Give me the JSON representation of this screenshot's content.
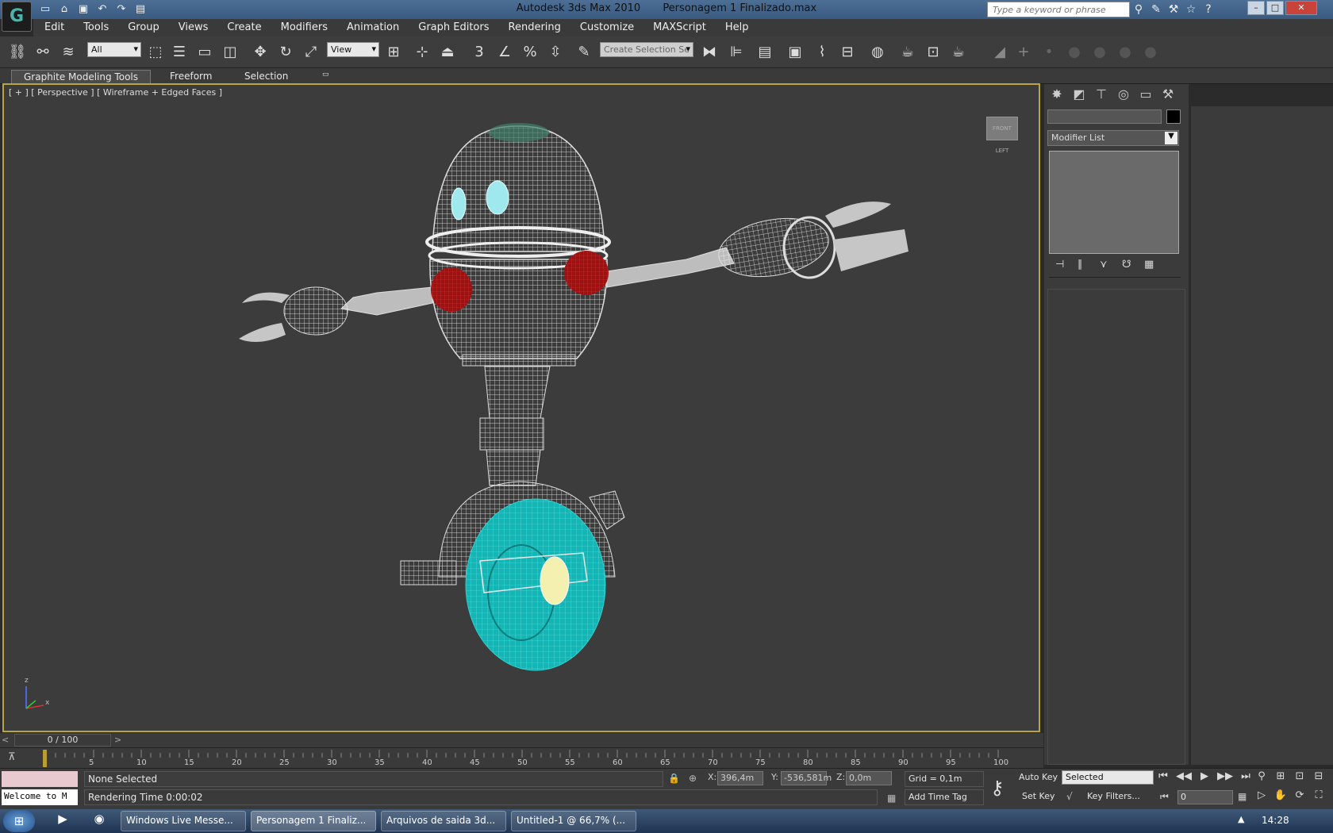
{
  "window": {
    "app_title": "Autodesk 3ds Max  2010",
    "file_title": "Personagem 1 Finalizado.max",
    "search_placeholder": "Type a keyword or phrase"
  },
  "menu": [
    "Edit",
    "Tools",
    "Group",
    "Views",
    "Create",
    "Modifiers",
    "Animation",
    "Graph Editors",
    "Rendering",
    "Customize",
    "MAXScript",
    "Help"
  ],
  "toolbar": {
    "filter_value": "All",
    "refcoord_value": "View",
    "selection_set_placeholder": "Create Selection Se",
    "snap_label": "3"
  },
  "ribbon": {
    "tabs": [
      "Graphite Modeling Tools",
      "Freeform",
      "Selection"
    ]
  },
  "viewport": {
    "label": "[ + ] [ Perspective ] [ Wireframe + Edged Faces ]",
    "viewcube_text": "FRONT  LEFT",
    "axis_z": "z",
    "axis_x": "x"
  },
  "command_panel": {
    "modifier_list": "Modifier List"
  },
  "timeslider": {
    "frame_text": "0 / 100",
    "ticks": [
      "5",
      "10",
      "15",
      "20",
      "25",
      "30",
      "35",
      "40",
      "45",
      "50",
      "55",
      "60",
      "65",
      "70",
      "75",
      "80",
      "85",
      "90",
      "95",
      "100"
    ]
  },
  "status": {
    "maxscript_text": "Welcome to M",
    "selection": "None Selected",
    "prompt": "Rendering Time  0:00:02",
    "x_label": "X:",
    "x_value": "396,4m",
    "y_label": "Y:",
    "y_value": "-536,581m",
    "z_label": "Z:",
    "z_value": "0,0m",
    "grid": "Grid = 0,1m",
    "add_time_tag": "Add Time Tag",
    "auto_key": "Auto Key",
    "set_key": "Set Key",
    "selected_dropdown": "Selected",
    "key_filters": "Key Filters...",
    "current_frame": "0"
  },
  "taskbar": {
    "tasks": [
      "Windows Live Messe...",
      "Personagem 1 Finaliz...",
      "Arquivos de saida 3d...",
      "Untitled-1 @ 66,7% (..."
    ],
    "clock": "14:28"
  },
  "colors": {
    "viewport_bg": "#3c3c3c",
    "active_border": "#b8a540",
    "wire_white": "#f2f2f2",
    "wheel_cyan": "#12b8b8",
    "joint_red": "#b01818",
    "eye_cyan": "#9fe9ee",
    "hub_yellow": "#f4f0b0"
  }
}
